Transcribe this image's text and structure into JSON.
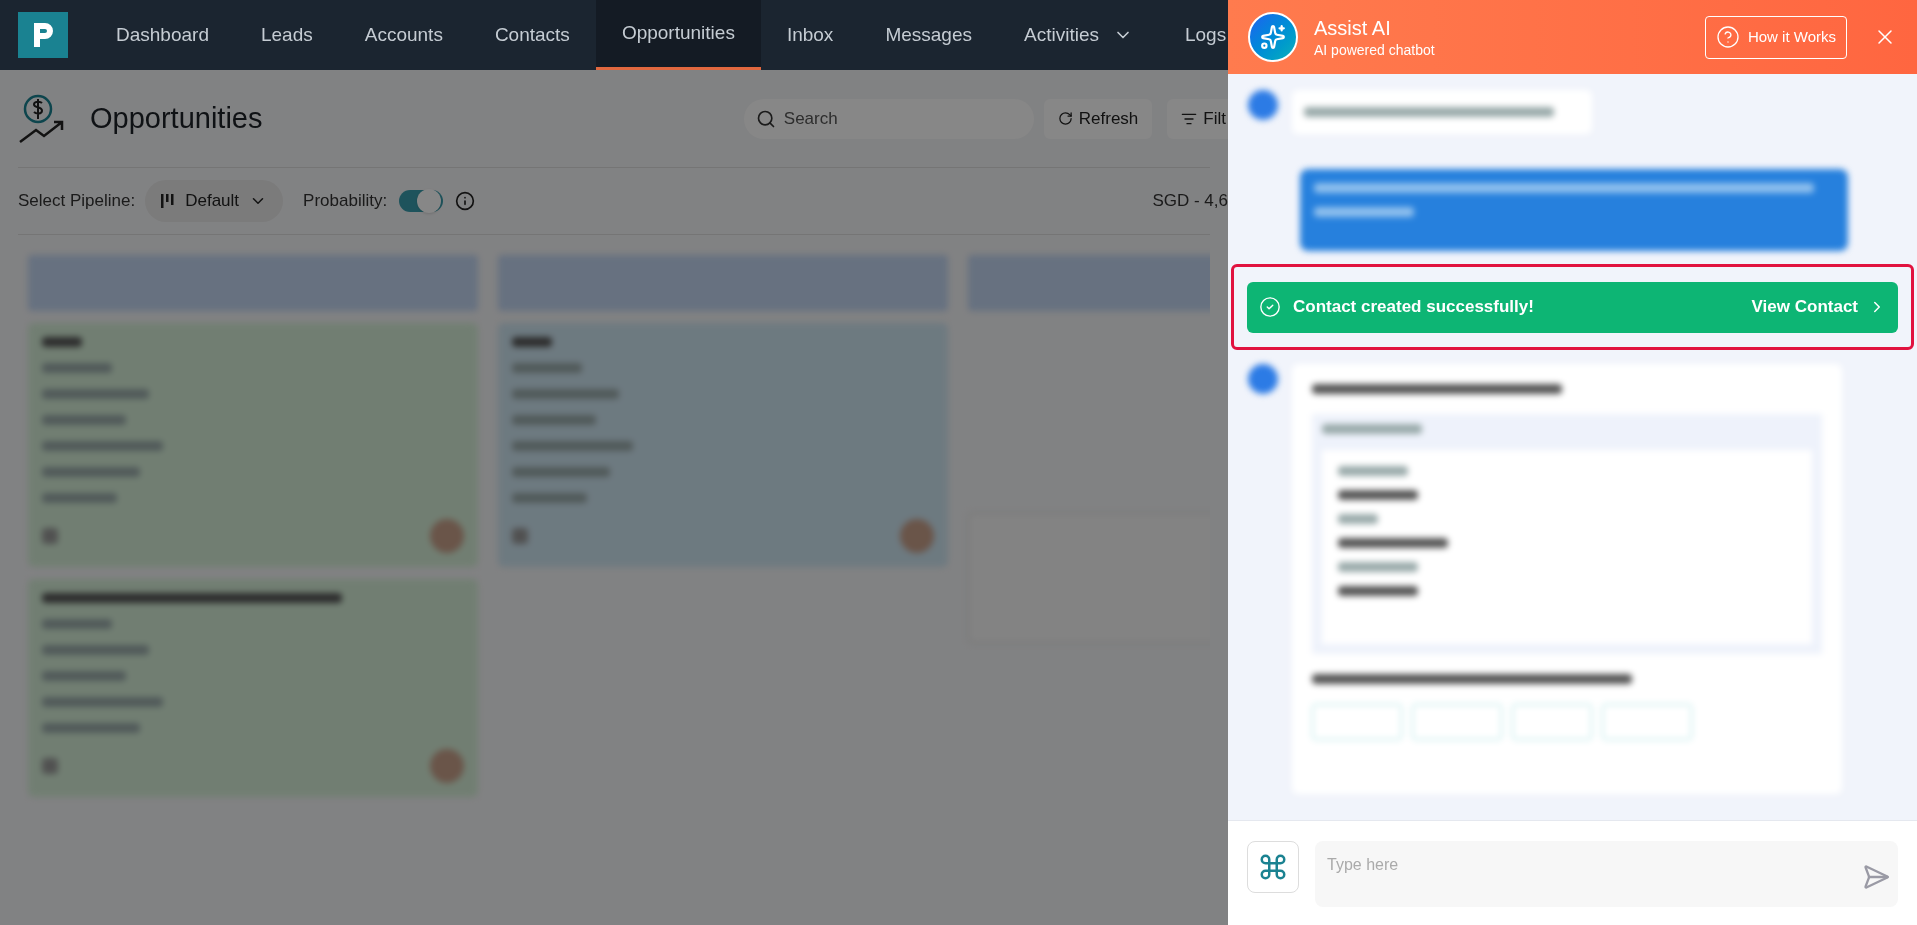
{
  "nav": {
    "items": [
      {
        "label": "Dashboard",
        "selected": false,
        "has_menu": false
      },
      {
        "label": "Leads",
        "selected": false,
        "has_menu": false
      },
      {
        "label": "Accounts",
        "selected": false,
        "has_menu": false
      },
      {
        "label": "Contacts",
        "selected": false,
        "has_menu": false
      },
      {
        "label": "Opportunities",
        "selected": true,
        "has_menu": false
      },
      {
        "label": "Inbox",
        "selected": false,
        "has_menu": false
      },
      {
        "label": "Messages",
        "selected": false,
        "has_menu": false
      },
      {
        "label": "Activities",
        "selected": false,
        "has_menu": true
      },
      {
        "label": "Logs",
        "selected": false,
        "has_menu": false
      }
    ]
  },
  "page": {
    "title": "Opportunities",
    "search": {
      "placeholder": "Search"
    },
    "buttons": [
      {
        "label": "Refresh",
        "kind": "refresh"
      },
      {
        "label": "Filt",
        "kind": "filter"
      }
    ],
    "pipeline_label": "Select Pipeline:",
    "pipeline": "Default",
    "probability_label": "Probability:",
    "probability_on": true,
    "total": "SGD - 4,6"
  },
  "assistant": {
    "title": "Assist AI",
    "subtitle": "AI powered chatbot",
    "help_button": "How it Works",
    "toast": {
      "message": "Contact created successfully!",
      "action": "View Contact"
    },
    "input": {
      "placeholder": "Type here"
    }
  }
}
